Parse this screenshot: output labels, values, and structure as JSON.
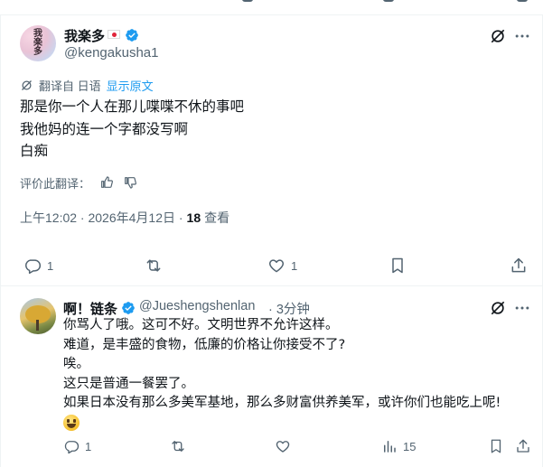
{
  "tweet": {
    "author": {
      "name": "我楽多",
      "handle": "@kengakusha1"
    },
    "avatar_text": [
      "我",
      "楽",
      "多"
    ],
    "translation": {
      "label": "翻译自 日语",
      "show_original": "显示原文"
    },
    "lines": [
      "那是你一个人在那儿喋喋不休的事吧",
      "我他妈的连一个字都没写啊",
      "白痴"
    ],
    "rate_label": "评价此翻译：",
    "timestamp": "上午12:02 · 2026年4月12日 · ",
    "views_count": "18",
    "views_label": "查看",
    "replies": "1",
    "likes": "1"
  },
  "reply": {
    "author": {
      "name": "啊！链条",
      "handle": "@Jueshengshenlan",
      "time": "· 3分钟"
    },
    "lines": [
      "你骂人了哦。这可不好。文明世界不允许这样。",
      "难道，是丰盛的食物，低廉的价格让你接受不了?",
      "唉。",
      "这只是普通一餐罢了。",
      "如果日本没有那么多美军基地，那么多财富供养美军，或许你们也能吃上呢!"
    ],
    "replies": "1",
    "views": "15"
  },
  "icons": {
    "verified": "verified-badge-icon",
    "grok": "grok-icon",
    "more": "more-icon",
    "reply": "reply-icon",
    "retweet": "retweet-icon",
    "like": "like-icon",
    "bookmark": "bookmark-icon",
    "share": "share-icon",
    "views": "views-icon"
  },
  "colors": {
    "accent": "#1d9bf0",
    "text": "#0f1419",
    "muted": "#536471",
    "border": "#eff3f4"
  }
}
